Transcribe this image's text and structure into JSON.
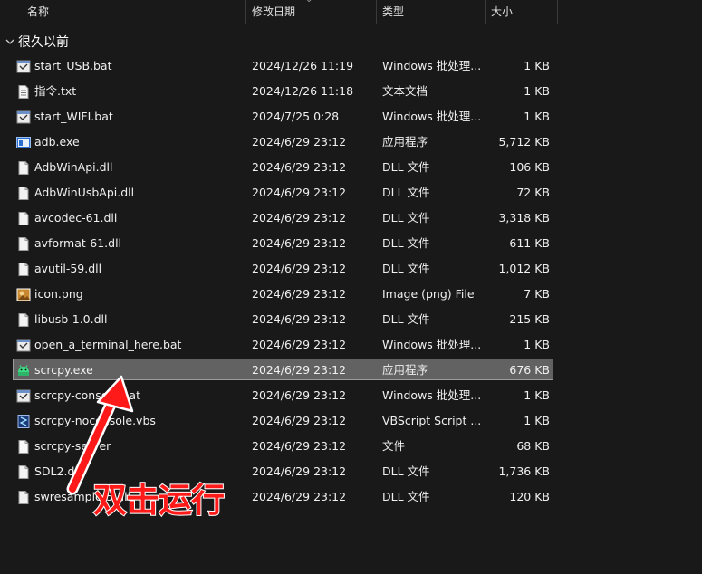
{
  "columns": {
    "name": "名称",
    "date": "修改日期",
    "type": "类型",
    "size": "大小"
  },
  "group": {
    "label": "很久以前"
  },
  "files": [
    {
      "name": "start_USB.bat",
      "date": "2024/12/26 11:19",
      "type": "Windows 批处理...",
      "size": "1 KB",
      "icon": "batch-file-icon"
    },
    {
      "name": "指令.txt",
      "date": "2024/12/26 11:18",
      "type": "文本文档",
      "size": "1 KB",
      "icon": "text-file-icon"
    },
    {
      "name": "start_WIFI.bat",
      "date": "2024/7/25 0:28",
      "type": "Windows 批处理...",
      "size": "1 KB",
      "icon": "batch-file-icon"
    },
    {
      "name": "adb.exe",
      "date": "2024/6/29 23:12",
      "type": "应用程序",
      "size": "5,712 KB",
      "icon": "application-icon"
    },
    {
      "name": "AdbWinApi.dll",
      "date": "2024/6/29 23:12",
      "type": "DLL 文件",
      "size": "106 KB",
      "icon": "dll-file-icon"
    },
    {
      "name": "AdbWinUsbApi.dll",
      "date": "2024/6/29 23:12",
      "type": "DLL 文件",
      "size": "72 KB",
      "icon": "dll-file-icon"
    },
    {
      "name": "avcodec-61.dll",
      "date": "2024/6/29 23:12",
      "type": "DLL 文件",
      "size": "3,318 KB",
      "icon": "dll-file-icon"
    },
    {
      "name": "avformat-61.dll",
      "date": "2024/6/29 23:12",
      "type": "DLL 文件",
      "size": "611 KB",
      "icon": "dll-file-icon"
    },
    {
      "name": "avutil-59.dll",
      "date": "2024/6/29 23:12",
      "type": "DLL 文件",
      "size": "1,012 KB",
      "icon": "dll-file-icon"
    },
    {
      "name": "icon.png",
      "date": "2024/6/29 23:12",
      "type": "Image (png) File",
      "size": "7 KB",
      "icon": "image-file-icon"
    },
    {
      "name": "libusb-1.0.dll",
      "date": "2024/6/29 23:12",
      "type": "DLL 文件",
      "size": "215 KB",
      "icon": "dll-file-icon"
    },
    {
      "name": "open_a_terminal_here.bat",
      "date": "2024/6/29 23:12",
      "type": "Windows 批处理...",
      "size": "1 KB",
      "icon": "batch-file-icon"
    },
    {
      "name": "scrcpy.exe",
      "date": "2024/6/29 23:12",
      "type": "应用程序",
      "size": "676 KB",
      "icon": "android-app-icon",
      "selected": true
    },
    {
      "name": "scrcpy-console.bat",
      "date": "2024/6/29 23:12",
      "type": "Windows 批处理...",
      "size": "1 KB",
      "icon": "batch-file-icon"
    },
    {
      "name": "scrcpy-noconsole.vbs",
      "date": "2024/6/29 23:12",
      "type": "VBScript Script ...",
      "size": "1 KB",
      "icon": "vbscript-file-icon"
    },
    {
      "name": "scrcpy-server",
      "date": "2024/6/29 23:12",
      "type": "文件",
      "size": "68 KB",
      "icon": "blank-file-icon"
    },
    {
      "name": "SDL2.dll",
      "date": "2024/6/29 23:12",
      "type": "DLL 文件",
      "size": "1,736 KB",
      "icon": "dll-file-icon"
    },
    {
      "name": "swresample-5.dll",
      "date": "2024/6/29 23:12",
      "type": "DLL 文件",
      "size": "120 KB",
      "icon": "dll-file-icon"
    }
  ],
  "annotation": {
    "text": "双击运行",
    "color": "#ff1a1a"
  },
  "colors": {
    "background": "#191919",
    "selection": "#626262",
    "selection_border": "#9c9c9c"
  }
}
